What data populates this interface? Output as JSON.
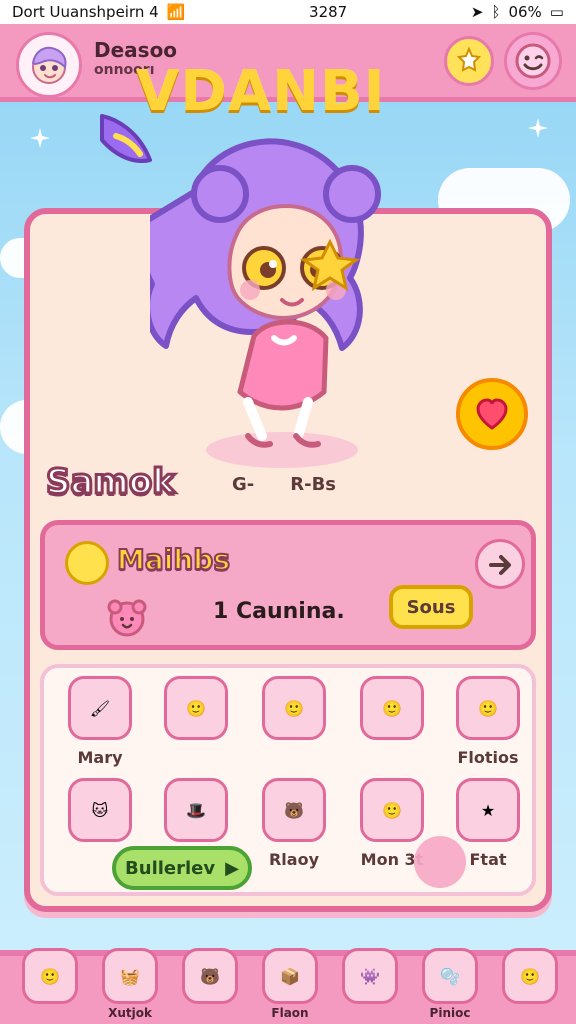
{
  "status_bar": {
    "carrier": "Dort Uuanshpeirn 4",
    "time": "3287",
    "battery": "06%"
  },
  "top_bar": {
    "user_title": "Deasoo",
    "user_subtitle": "onnoorı"
  },
  "logo": {
    "text": "VDANBI"
  },
  "character": {
    "name": "Samok",
    "stat_left": "G-",
    "stat_right": "R-Bs"
  },
  "missions": {
    "title": "Maihbs",
    "count_text": "1 Caunina.",
    "button_label": "Sous"
  },
  "collection": {
    "tiles": [
      {
        "label": "Mary"
      },
      {
        "label": ""
      },
      {
        "label": ""
      },
      {
        "label": ""
      },
      {
        "label": "Flotios"
      },
      {
        "label": ""
      },
      {
        "label": ""
      },
      {
        "label": "Rlaoy"
      },
      {
        "label": "Mon 3t"
      },
      {
        "label": "Ftat"
      }
    ],
    "pill_label": "Bullerlev"
  },
  "bottom_nav": {
    "items": [
      {
        "label": ""
      },
      {
        "label": "Xutjok"
      },
      {
        "label": ""
      },
      {
        "label": "Flaon"
      },
      {
        "label": ""
      },
      {
        "label": "Pinioc"
      },
      {
        "label": ""
      }
    ]
  },
  "colors": {
    "pink": "#f49ac1",
    "pink_dark": "#e16a9a",
    "cream": "#fde9db",
    "sky": "#8fd3f4",
    "yellow": "#ffd43b"
  }
}
